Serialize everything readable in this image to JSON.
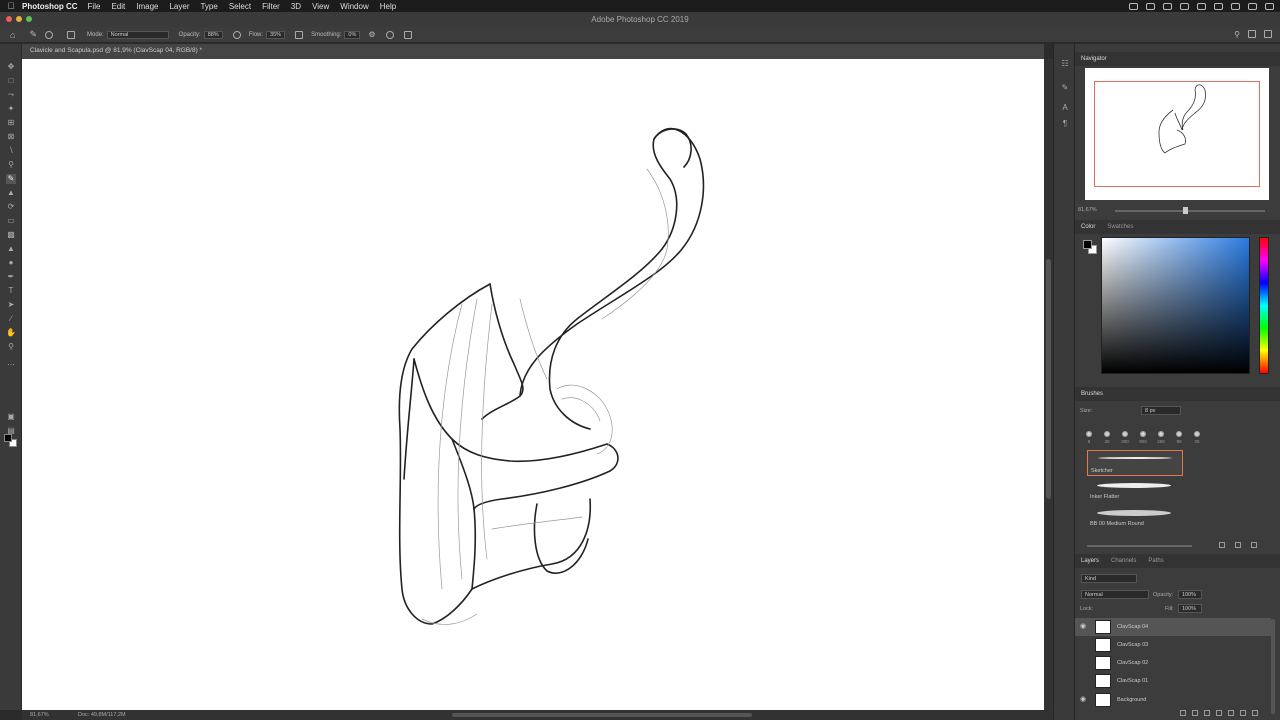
{
  "menubar": {
    "app_name": "Photoshop CC",
    "items": [
      "File",
      "Edit",
      "Image",
      "Layer",
      "Type",
      "Select",
      "Filter",
      "3D",
      "View",
      "Window",
      "Help"
    ]
  },
  "window": {
    "title": "Adobe Photoshop CC 2019"
  },
  "options_bar": {
    "mode_label": "Mode:",
    "mode_value": "Normal",
    "opacity_label": "Opacity:",
    "opacity_value": "88%",
    "flow_label": "Flow:",
    "flow_value": "35%",
    "smoothing_label": "Smoothing:",
    "smoothing_value": "0%"
  },
  "document": {
    "tab_title": "Clavicle and Scapula.psd @ 81,9% (ClavScap 04, RGB/8) *"
  },
  "status_bar": {
    "zoom": "81,67%",
    "doc_info": "Doc: 49,8M/117,2M"
  },
  "navigator": {
    "tab_label": "Navigator",
    "zoom": "81,67%"
  },
  "color_panel": {
    "tabs": [
      "Color",
      "Swatches"
    ],
    "foreground": "#000000",
    "background": "#ffffff",
    "hue_color": "#2a7ae0"
  },
  "brushes_panel": {
    "tab_label": "Brushes",
    "size_label": "Size:",
    "size_value": "8 px",
    "tip_sizes": [
      "8",
      "30",
      "200",
      "900",
      "256",
      "90",
      "25"
    ],
    "presets": [
      {
        "name": "Sketcher",
        "selected": true
      },
      {
        "name": "Inker Flatter",
        "selected": false
      },
      {
        "name": "BB 00 Medium Round",
        "selected": false
      }
    ]
  },
  "layers_panel": {
    "tabs": [
      "Layers",
      "Channels",
      "Paths"
    ],
    "filter_value": "Kind",
    "blend_mode": "Normal",
    "opacity_label": "Opacity:",
    "opacity_value": "100%",
    "lock_label": "Lock:",
    "fill_label": "Fill:",
    "fill_value": "100%",
    "layers": [
      {
        "name": "ClavScap 04",
        "visible": true,
        "selected": true
      },
      {
        "name": "ClavScap 03",
        "visible": false,
        "selected": false
      },
      {
        "name": "ClavScap 02",
        "visible": false,
        "selected": false
      },
      {
        "name": "ClavScap 01",
        "visible": false,
        "selected": false
      },
      {
        "name": "Background",
        "visible": true,
        "selected": false
      }
    ]
  }
}
